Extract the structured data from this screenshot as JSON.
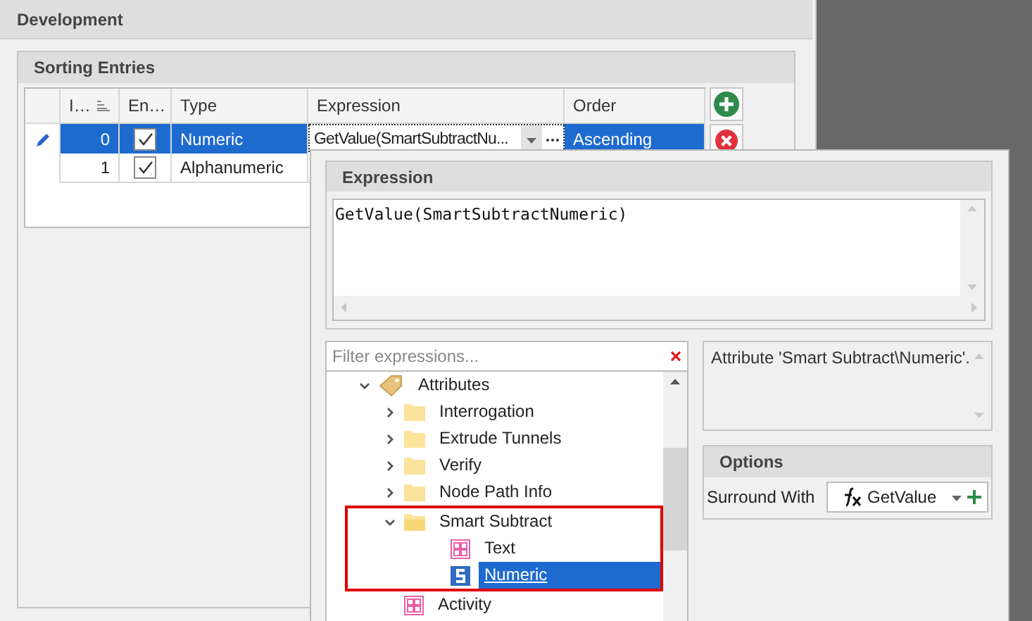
{
  "panel": {
    "title": "Development"
  },
  "sorting": {
    "title": "Sorting Entries",
    "columns": [
      {
        "label": "I…",
        "sortable": true
      },
      {
        "label": "En…",
        "sortable": false
      },
      {
        "label": "Type",
        "sortable": false
      },
      {
        "label": "Expression",
        "sortable": false
      },
      {
        "label": "Order",
        "sortable": false
      }
    ],
    "rows": [
      {
        "index": "0",
        "enabled": true,
        "type": "Numeric",
        "expression": "GetValue(SmartSubtractNu...",
        "order": "Ascending",
        "selected": true
      },
      {
        "index": "1",
        "enabled": true,
        "type": "Alphanumeric",
        "selected": false
      }
    ]
  },
  "popup": {
    "expression": {
      "title": "Expression",
      "value": "GetValue(SmartSubtractNumeric)"
    },
    "filter": {
      "placeholder": "Filter expressions..."
    },
    "tree": [
      {
        "label": "Attributes",
        "kind": "attributes",
        "expanded": true,
        "selected": false,
        "highlighted": false,
        "children": [
          {
            "label": "Interrogation",
            "kind": "folder",
            "expanded": false,
            "selected": false,
            "highlighted": false
          },
          {
            "label": "Extrude Tunnels",
            "kind": "folder",
            "expanded": false,
            "selected": false,
            "highlighted": false
          },
          {
            "label": "Verify",
            "kind": "folder",
            "expanded": false,
            "selected": false,
            "highlighted": false
          },
          {
            "label": "Node Path Info",
            "kind": "folder",
            "expanded": false,
            "selected": false,
            "highlighted": false
          },
          {
            "label": "Smart Subtract",
            "kind": "folder",
            "expanded": true,
            "selected": false,
            "highlighted": true,
            "children": [
              {
                "label": "Text",
                "kind": "text",
                "selected": false,
                "highlighted": false
              },
              {
                "label": "Numeric",
                "kind": "numeric",
                "selected": true,
                "highlighted": false
              }
            ]
          },
          {
            "label": "Activity",
            "kind": "text",
            "selected": false,
            "highlighted": false
          }
        ]
      }
    ],
    "description": "Attribute 'Smart Subtract\\Numeric'.",
    "options": {
      "title": "Options",
      "surround_label": "Surround With",
      "surround_value": "GetValue"
    }
  }
}
